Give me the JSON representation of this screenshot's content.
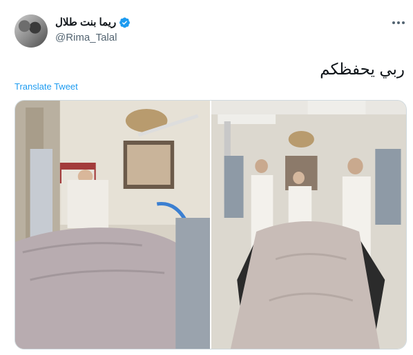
{
  "author": {
    "display_name": "ريما بنت طلال",
    "handle": "@Rima_Talal",
    "avatar_icon": "avatar-photo",
    "verified_icon": "verified-badge-icon",
    "verified_color": "#1d9bf0"
  },
  "tweet": {
    "text": "ربي يحفظكم",
    "translate_label": "Translate Tweet"
  },
  "menu_icon": "more-options-icon",
  "media": {
    "photos": [
      {
        "name": "hospital-photo-left",
        "description_icon": "photo"
      },
      {
        "name": "hospital-photo-right",
        "description_icon": "photo"
      }
    ]
  },
  "colors": {
    "link": "#1d9bf0",
    "secondary_text": "#536471",
    "border": "#cfd9de"
  }
}
